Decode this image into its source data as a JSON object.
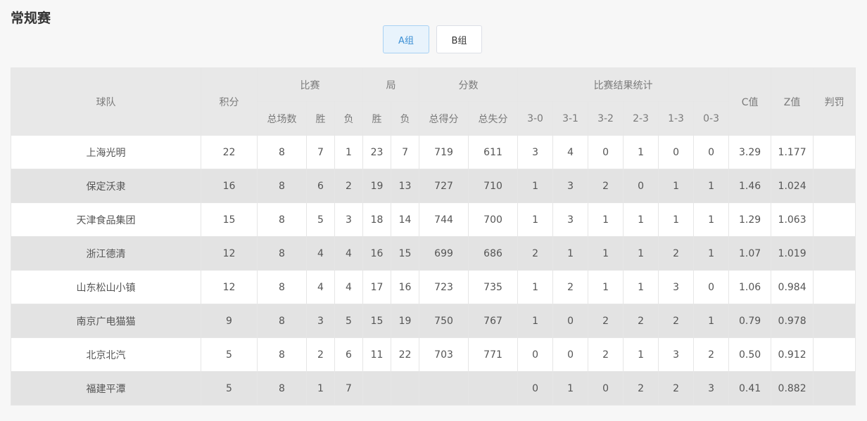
{
  "page": {
    "title": "常规赛"
  },
  "tabs": [
    {
      "label": "A组",
      "active": true
    },
    {
      "label": "B组",
      "active": false
    }
  ],
  "headers": {
    "team": "球队",
    "points": "积分",
    "matches": "比赛",
    "sets": "局",
    "scores": "分数",
    "results": "比赛结果统计",
    "c_value": "C值",
    "z_value": "Z值",
    "penalty": "判罚",
    "total_matches": "总场数",
    "win": "胜",
    "loss": "负",
    "set_win": "胜",
    "set_loss": "负",
    "total_scored": "总得分",
    "total_conceded": "总失分",
    "r30": "3-0",
    "r31": "3-1",
    "r32": "3-2",
    "r23": "2-3",
    "r13": "1-3",
    "r03": "0-3"
  },
  "rows": [
    [
      "上海光明",
      "22",
      "8",
      "7",
      "1",
      "23",
      "7",
      "719",
      "611",
      "3",
      "4",
      "0",
      "1",
      "0",
      "0",
      "3.29",
      "1.177",
      ""
    ],
    [
      "保定沃隶",
      "16",
      "8",
      "6",
      "2",
      "19",
      "13",
      "727",
      "710",
      "1",
      "3",
      "2",
      "0",
      "1",
      "1",
      "1.46",
      "1.024",
      ""
    ],
    [
      "天津食品集团",
      "15",
      "8",
      "5",
      "3",
      "18",
      "14",
      "744",
      "700",
      "1",
      "3",
      "1",
      "1",
      "1",
      "1",
      "1.29",
      "1.063",
      ""
    ],
    [
      "浙江德清",
      "12",
      "8",
      "4",
      "4",
      "16",
      "15",
      "699",
      "686",
      "2",
      "1",
      "1",
      "1",
      "2",
      "1",
      "1.07",
      "1.019",
      ""
    ],
    [
      "山东松山小镇",
      "12",
      "8",
      "4",
      "4",
      "17",
      "16",
      "723",
      "735",
      "1",
      "2",
      "1",
      "1",
      "3",
      "0",
      "1.06",
      "0.984",
      ""
    ],
    [
      "南京广电猫猫",
      "9",
      "8",
      "3",
      "5",
      "15",
      "19",
      "750",
      "767",
      "1",
      "0",
      "2",
      "2",
      "2",
      "1",
      "0.79",
      "0.978",
      ""
    ],
    [
      "北京北汽",
      "5",
      "8",
      "2",
      "6",
      "11",
      "22",
      "703",
      "771",
      "0",
      "0",
      "2",
      "1",
      "3",
      "2",
      "0.50",
      "0.912",
      ""
    ],
    [
      "福建平潭",
      "5",
      "8",
      "1",
      "7",
      "",
      "",
      "",
      "",
      "0",
      "1",
      "0",
      "2",
      "2",
      "3",
      "0.41",
      "0.882",
      ""
    ]
  ]
}
